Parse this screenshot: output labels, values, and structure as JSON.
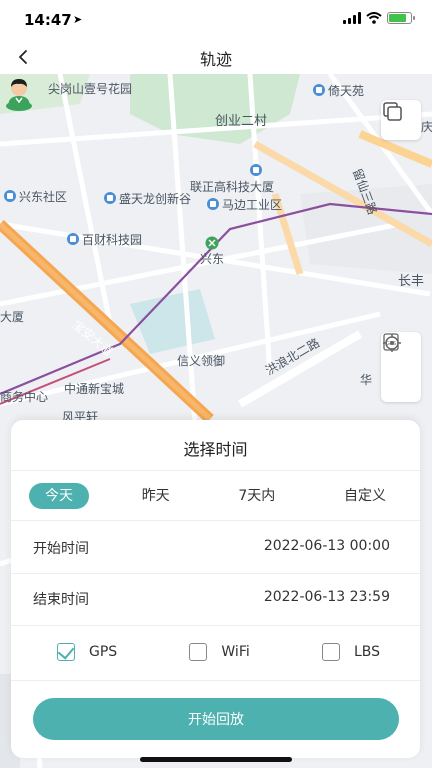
{
  "status_bar": {
    "time": "14:47",
    "battery_color": "#41c34a"
  },
  "nav": {
    "title": "轨迹"
  },
  "map": {
    "labels": {
      "l1": "尖岗山壹号花园",
      "l2": "倚天苑",
      "l3": "创业二村",
      "l4": "庆",
      "l5": "联正高科技大厦",
      "l6": "留仙三路",
      "l7": "兴东社区",
      "l8": "盛天龙创新谷",
      "l9": "马边工业区",
      "l10": "百财科技园",
      "l11": "兴东",
      "l12": "长丰",
      "l13": "大厦",
      "l14": "宝安大道",
      "l15": "信义领御",
      "l16": "洪浪北二路",
      "l17": "华",
      "l18": "商务中心",
      "l19": "中通新宝城",
      "l20": "风平轩"
    }
  },
  "sheet": {
    "title": "选择时间",
    "tabs": [
      "今天",
      "昨天",
      "7天内",
      "自定义"
    ],
    "start_label": "开始时间",
    "start_value": "2022-06-13 00:00",
    "end_label": "结束时间",
    "end_value": "2022-06-13 23:59",
    "options": [
      {
        "label": "GPS",
        "checked": true
      },
      {
        "label": "WiFi",
        "checked": false
      },
      {
        "label": "LBS",
        "checked": false
      }
    ],
    "start_button": "开始回放"
  },
  "colors": {
    "accent": "#4db1b0",
    "road_major": "#f5a651",
    "metro": "#8a4f9e"
  }
}
